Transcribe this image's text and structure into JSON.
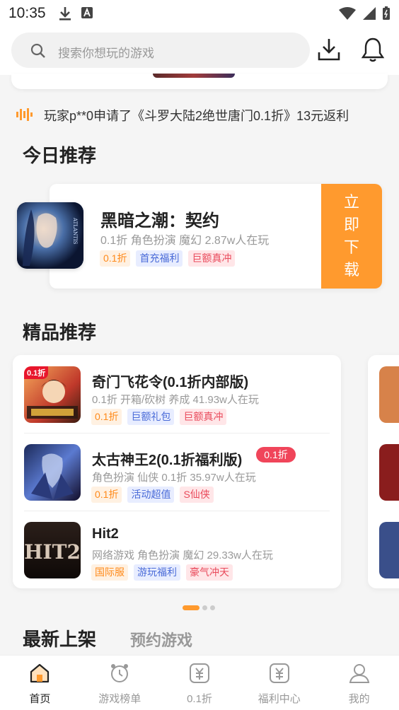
{
  "status": {
    "time": "10:35"
  },
  "search": {
    "placeholder": "搜索你想玩的游戏"
  },
  "ticker": {
    "text": "玩家p**0申请了《斗罗大陆2绝世唐门0.1折》13元返利"
  },
  "today": {
    "section_title": "今日推荐",
    "game": {
      "name": "黑暗之潮：契约",
      "meta": "0.1折 角色扮演 魔幻 2.87w人在玩",
      "icon_text": "ATLANTIS",
      "tags": [
        {
          "label": "0.1折",
          "style": "orange"
        },
        {
          "label": "首充福利",
          "style": "blue"
        },
        {
          "label": "巨额真冲",
          "style": "red"
        }
      ]
    },
    "download_label": [
      "立",
      "即",
      "下",
      "载"
    ]
  },
  "premium": {
    "section_title": "精品推荐",
    "games": [
      {
        "name": "奇门飞花令(0.1折内部版)",
        "meta": "0.1折 开箱/砍树 养成  41.93w人在玩",
        "badge": "0.1折",
        "tags": [
          {
            "label": "0.1折",
            "style": "orange"
          },
          {
            "label": "巨额礼包",
            "style": "blue"
          },
          {
            "label": "巨额真冲",
            "style": "red"
          }
        ]
      },
      {
        "name": "太古神王2(0.1折福利版)",
        "meta": "角色扮演 仙侠 0.1折  35.97w人在玩",
        "discount": "0.1折",
        "tags": [
          {
            "label": "0.1折",
            "style": "orange"
          },
          {
            "label": "活动超值",
            "style": "blue"
          },
          {
            "label": "S仙侠",
            "style": "red"
          }
        ]
      },
      {
        "name": "Hit2",
        "meta": "网络游戏 角色扮演 魔幻  29.33w人在玩",
        "icon_text": "HIT2",
        "tags": [
          {
            "label": "国际服",
            "style": "orange"
          },
          {
            "label": "游玩福利",
            "style": "blue"
          },
          {
            "label": "豪气冲天",
            "style": "red"
          }
        ]
      }
    ]
  },
  "tabs": {
    "latest": "最新上架",
    "reserve": "预约游戏"
  },
  "bottom_nav": [
    {
      "label": "首页",
      "icon": "home-icon",
      "active": true
    },
    {
      "label": "游戏榜单",
      "icon": "ranking-icon",
      "active": false
    },
    {
      "label": "0.1折",
      "icon": "discount-icon",
      "active": false
    },
    {
      "label": "福利中心",
      "icon": "welfare-icon",
      "active": false
    },
    {
      "label": "我的",
      "icon": "profile-icon",
      "active": false
    }
  ],
  "colors": {
    "accent": "#ff9a2e",
    "discount_red": "#f0455a"
  }
}
